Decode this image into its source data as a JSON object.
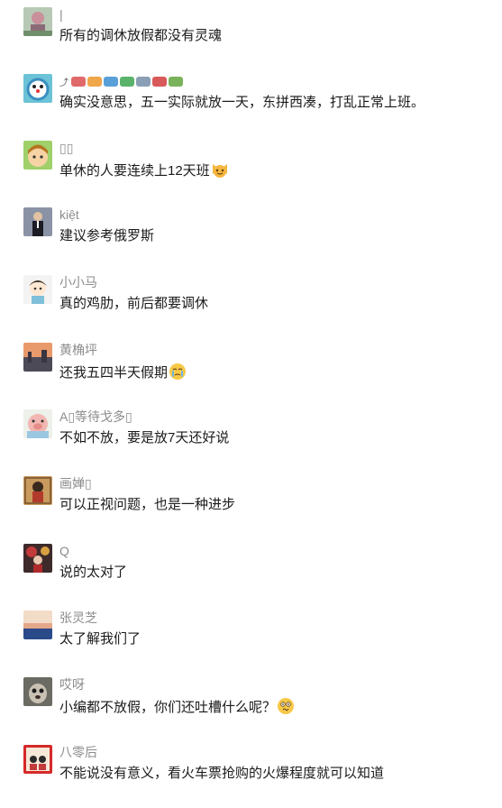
{
  "comments": [
    {
      "name": "|",
      "text": "所有的调休放假都没有灵魂"
    },
    {
      "name": "",
      "text": "确实没意思，五一实际就放一天，东拼西凑，打乱正常上班。"
    },
    {
      "name": "▯▯",
      "text": "单休的人要连续上12天班"
    },
    {
      "name": "kiệt",
      "text": "建议参考俄罗斯"
    },
    {
      "name": "小小马",
      "text": "真的鸡肋，前后都要调休"
    },
    {
      "name": "黄桷坪",
      "text": "还我五四半天假期"
    },
    {
      "name": "A▯等待戈多▯",
      "text": "不如不放，要是放7天还好说"
    },
    {
      "name": "画婵▯",
      "text": "可以正视问题，也是一种进步"
    },
    {
      "name": "Q",
      "text": "说的太对了"
    },
    {
      "name": "张灵芝",
      "text": "太了解我们了"
    },
    {
      "name": "哎呀",
      "text": "小编都不放假，你们还吐槽什么呢？"
    },
    {
      "name": "八零后",
      "text": "不能说没有意义，看火车票抢购的火爆程度就可以知道"
    }
  ],
  "icons": {
    "name_1_decor": "car-row-icons",
    "text_2_emoji": "cat-face-emoji",
    "text_5_emoji": "crying-face-emoji",
    "text_10_emoji": "dizzy-face-emoji"
  }
}
